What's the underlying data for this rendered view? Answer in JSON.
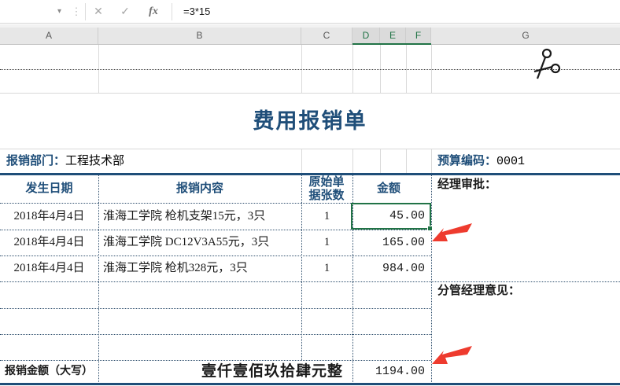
{
  "formula_bar": {
    "name_box_value": "",
    "dropdown_icon": "▾",
    "separator_dots_icon": "⋮",
    "cancel_icon": "✕",
    "confirm_icon": "✓",
    "function_icon": "fx",
    "formula": "=3*15"
  },
  "column_headers": {
    "labels": [
      "A",
      "B",
      "C",
      "D",
      "E",
      "F",
      "G"
    ],
    "selected": [
      "D",
      "E",
      "F"
    ]
  },
  "sheet": {
    "title": "费用报销单",
    "department_label": "报销部门：",
    "department_value": "工程技术部",
    "budget_label": "预算编码：",
    "budget_value": "0001",
    "manager_approval_label": "经理审批：",
    "deputy_manager_label": "分管经理意见：",
    "table": {
      "col_date": "发生日期",
      "col_content": "报销内容",
      "col_count": "原始单据张数",
      "col_amount": "金额",
      "rows": [
        {
          "date": "2018年4月4日",
          "content": "淮海工学院 枪机支架15元，3只",
          "count": "1",
          "amount": "45.00"
        },
        {
          "date": "2018年4月4日",
          "content": "淮海工学院 DC12V3A55元，3只",
          "count": "1",
          "amount": "165.00"
        },
        {
          "date": "2018年4月4日",
          "content": "淮海工学院 枪机328元，3只",
          "count": "1",
          "amount": "984.00"
        }
      ],
      "total_label": "报销金额（大写）",
      "total_in_words": "壹仟壹佰玖拾肆元整",
      "total_amount": "1194.00"
    },
    "colors": {
      "accent_blue": "#1f4e79",
      "selection_green": "#217346",
      "arrow_red": "#ee3b2e"
    }
  }
}
